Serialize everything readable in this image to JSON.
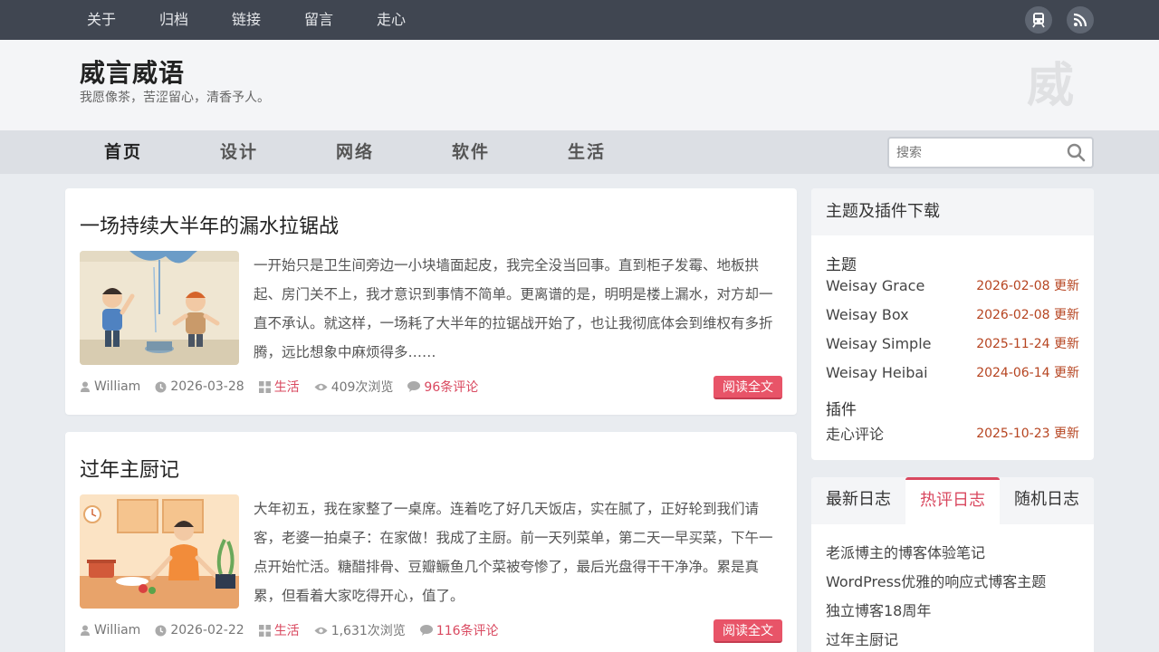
{
  "topnav": [
    "关于",
    "归档",
    "链接",
    "留言",
    "走心"
  ],
  "topicons": [
    {
      "name": "subway-icon"
    },
    {
      "name": "rss-icon"
    }
  ],
  "site": {
    "title": "威言威语",
    "description": "我愿像茶，苦涩留心，清香予人。",
    "logo_char": "威"
  },
  "mainnav": [
    {
      "label": "首页",
      "active": true
    },
    {
      "label": "设计",
      "active": false
    },
    {
      "label": "网络",
      "active": false
    },
    {
      "label": "软件",
      "active": false
    },
    {
      "label": "生活",
      "active": false
    }
  ],
  "search": {
    "placeholder": "搜索"
  },
  "posts": [
    {
      "title": "一场持续大半年的漏水拉锯战",
      "excerpt": "一开始只是卫生间旁边一小块墙面起皮，我完全没当回事。直到柜子发霉、地板拱起、房门关不上，我才意识到事情不简单。更离谱的是，明明是楼上漏水，对方却一直不承认。就这样，一场耗了大半年的拉锯战开始了，也让我彻底体会到维权有多折腾，远比想象中麻烦得多……",
      "author": "William",
      "date": "2026-03-28",
      "category": "生活",
      "views": "409次浏览",
      "comments": "96条评论",
      "read_more": "阅读全文"
    },
    {
      "title": "过年主厨记",
      "excerpt": "大年初五，我在家整了一桌席。连着吃了好几天饭店，实在腻了，正好轮到我们请客，老婆一拍桌子：在家做！我成了主厨。前一天列菜单，第二天一早买菜，下午一点开始忙活。糖醋排骨、豆瓣鳜鱼几个菜被夸惨了，最后光盘得干干净净。累是真累，但看着大家吃得开心，值了。",
      "author": "William",
      "date": "2026-02-22",
      "category": "生活",
      "views": "1,631次浏览",
      "comments": "116条评论",
      "read_more": "阅读全文"
    }
  ],
  "sidebar": {
    "downloads": {
      "title": "主题及插件下载",
      "themes_label": "主题",
      "themes": [
        {
          "name": "Weisay Grace",
          "date": "2026-02-08 更新"
        },
        {
          "name": "Weisay Box",
          "date": "2026-02-08 更新"
        },
        {
          "name": "Weisay Simple",
          "date": "2025-11-24 更新"
        },
        {
          "name": "Weisay Heibai",
          "date": "2024-06-14 更新"
        }
      ],
      "plugins_label": "插件",
      "plugins": [
        {
          "name": "走心评论",
          "date": "2025-10-23 更新"
        }
      ]
    },
    "tabs": [
      {
        "label": "最新日志",
        "active": false
      },
      {
        "label": "热评日志",
        "active": true
      },
      {
        "label": "随机日志",
        "active": false
      }
    ],
    "hot_posts": [
      "老派博主的博客体验笔记",
      "WordPress优雅的响应式博客主题",
      "独立博客18周年",
      "过年主厨记"
    ]
  },
  "colors": {
    "accent": "#e85468",
    "topbar": "#404651",
    "date": "#b64420"
  }
}
